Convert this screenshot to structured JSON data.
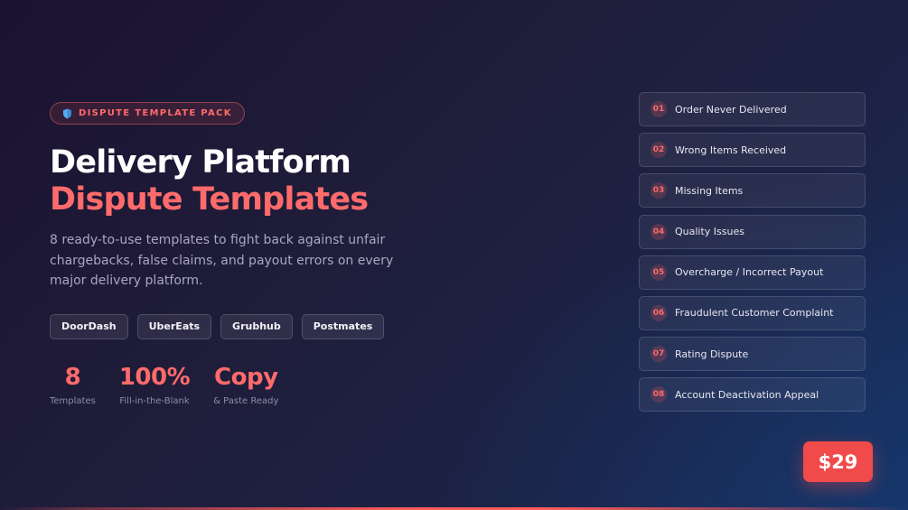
{
  "badge": {
    "icon": "shield-icon",
    "label": "DISPUTE TEMPLATE PACK"
  },
  "title": {
    "line1": "Delivery Platform",
    "line2": "Dispute Templates"
  },
  "description": "8 ready-to-use templates to fight back against unfair chargebacks, false claims, and payout errors on every major delivery platform.",
  "platforms": [
    "DoorDash",
    "UberEats",
    "Grubhub",
    "Postmates"
  ],
  "stats": [
    {
      "value": "8",
      "label": "Templates"
    },
    {
      "value": "100%",
      "label": "Fill-in-the-Blank"
    },
    {
      "value": "Copy",
      "label": "& Paste Ready"
    }
  ],
  "templates": [
    {
      "num": "01",
      "label": "Order Never Delivered"
    },
    {
      "num": "02",
      "label": "Wrong Items Received"
    },
    {
      "num": "03",
      "label": "Missing Items"
    },
    {
      "num": "04",
      "label": "Quality Issues"
    },
    {
      "num": "05",
      "label": "Overcharge / Incorrect Payout"
    },
    {
      "num": "06",
      "label": "Fraudulent Customer Complaint"
    },
    {
      "num": "07",
      "label": "Rating Dispute"
    },
    {
      "num": "08",
      "label": "Account Deactivation Appeal"
    }
  ],
  "price": "$29",
  "colors": {
    "accent": "#ff6b6b",
    "price_bg": "#f04a4a",
    "shield": "#5aa9f0"
  }
}
